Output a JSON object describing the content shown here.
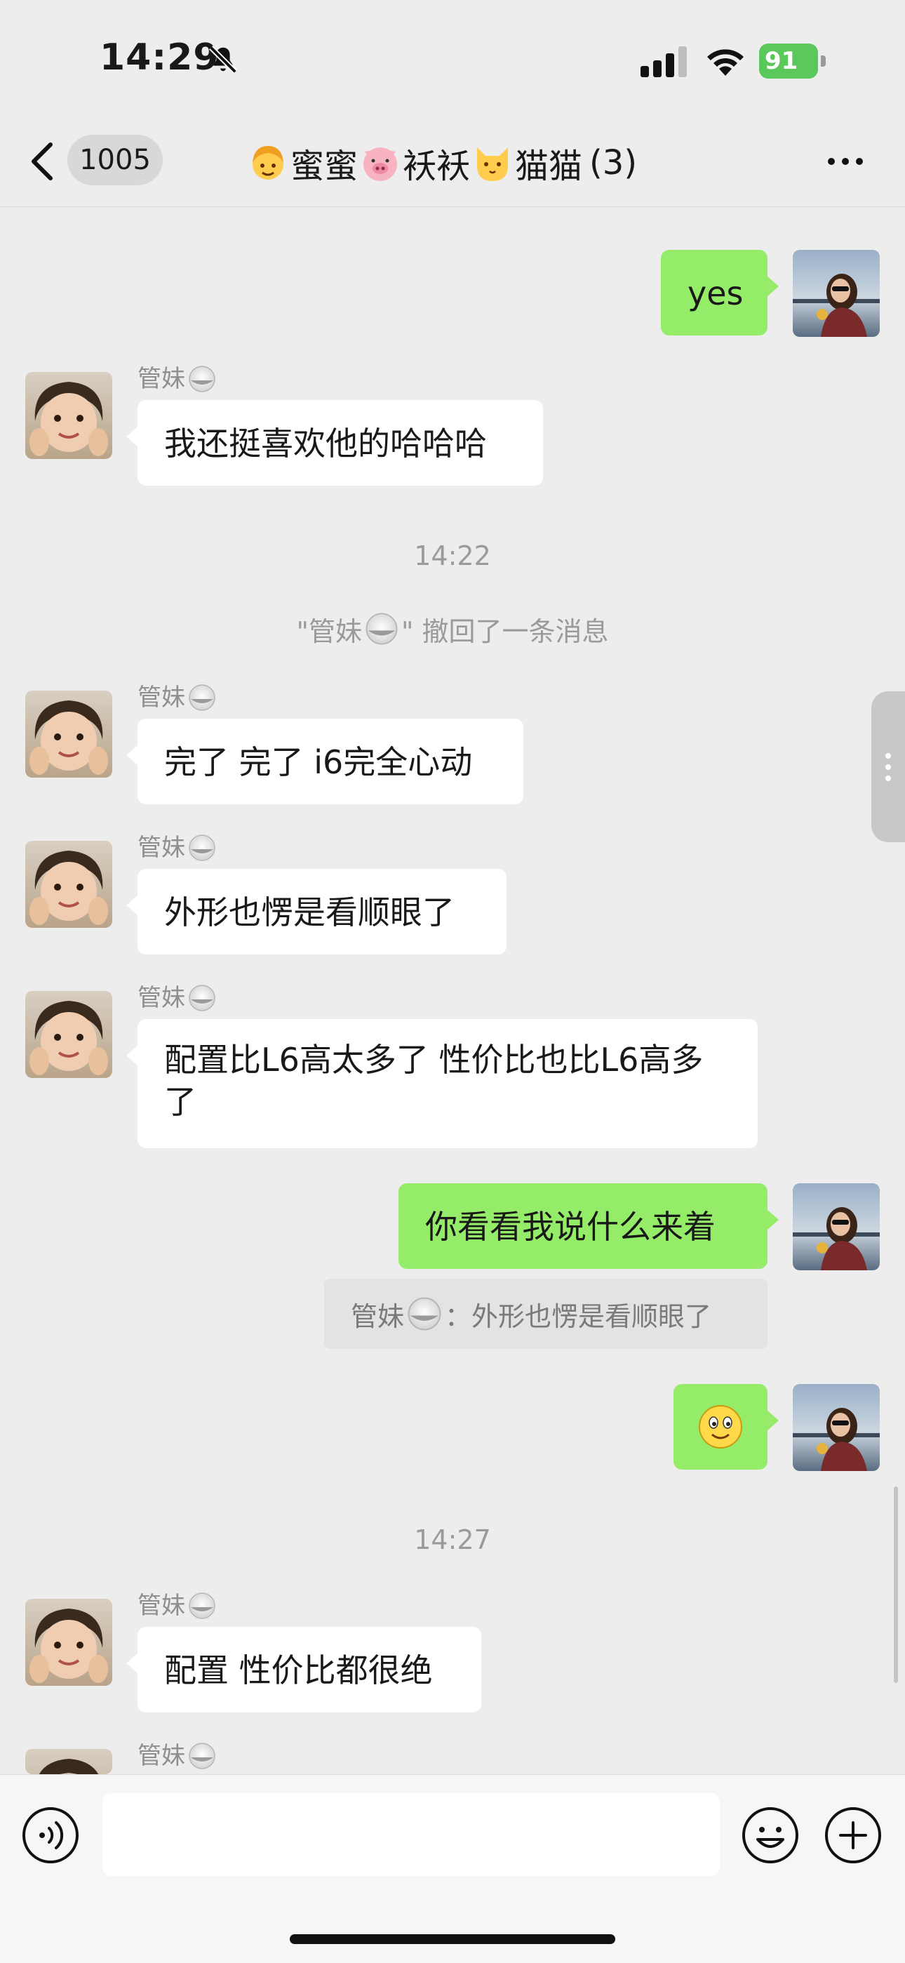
{
  "status_bar": {
    "time": "14:29",
    "battery": "91"
  },
  "nav": {
    "back_count": "1005",
    "title_parts": [
      "蜜蜜",
      "袄袄",
      "猫猫"
    ],
    "member_count": "(3)"
  },
  "messages": {
    "m1": {
      "text": "yes"
    },
    "m2": {
      "sender": "管妹",
      "text": "我还挺喜欢他的哈哈哈"
    },
    "t1": {
      "text": "14:22"
    },
    "recall": {
      "prefix": "\"管妹",
      "suffix": "\" 撤回了一条消息"
    },
    "m3": {
      "sender": "管妹",
      "text": "完了 完了 i6完全心动"
    },
    "m4": {
      "sender": "管妹",
      "text": "外形也愣是看顺眼了"
    },
    "m5": {
      "sender": "管妹",
      "text": "配置比L6高太多了 性价比也比L6高多了"
    },
    "m6": {
      "text": "你看看我说什么来着"
    },
    "quote": {
      "sender": "管妹",
      "sep": "：",
      "text": "外形也愣是看顺眼了"
    },
    "t2": {
      "text": "14:27"
    },
    "m8": {
      "sender": "管妹",
      "text": "配置 性价比都很绝"
    },
    "m9": {
      "sender": "管妹"
    }
  },
  "colors": {
    "background": "#ededed",
    "outgoing_bubble": "#95ec69",
    "incoming_bubble": "#ffffff",
    "battery": "#5ac85a"
  },
  "icons": {
    "nav": [
      "chevron-left-icon",
      "more-icon"
    ],
    "input": [
      "voice-icon",
      "emoji-icon",
      "plus-icon"
    ],
    "status": [
      "bell-slash-icon",
      "signal-icon",
      "wifi-icon",
      "battery-icon"
    ]
  }
}
